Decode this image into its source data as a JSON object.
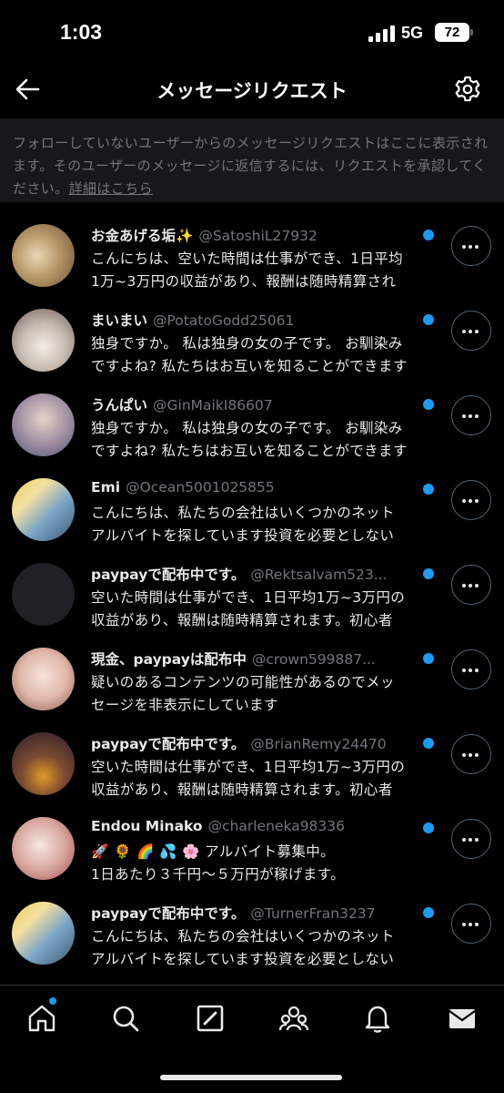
{
  "status_bar": {
    "time": "1:03",
    "network": "5G",
    "battery": "72"
  },
  "header": {
    "title": "メッセージリクエスト",
    "back_icon": "arrow-left-icon",
    "settings_icon": "gear-icon"
  },
  "notice": {
    "text": "フォローしていないユーザーからのメッセージリクエストはここに表示されます。そのユーザーのメッセージに返信するには、リクエストを承認してください。",
    "link": "詳細はこちら"
  },
  "requests": [
    {
      "name": "お金あげる垢✨",
      "handle": "@SatoshiL27932",
      "message": "こんにちは、空いた時間は仕事ができ、1日平均\n1万~3万円の収益があり、報酬は随時精算され",
      "unread": true
    },
    {
      "name": "まいまい",
      "handle": "@PotatoGodd25061",
      "message": "独身ですか。 私は独身の女の子です。 お馴染み\nですよね? 私たちはお互いを知ることができます",
      "unread": true
    },
    {
      "name": "うんぱい",
      "handle": "@GinMaikI86607",
      "message": "独身ですか。 私は独身の女の子です。 お馴染み\nですよね? 私たちはお互いを知ることができます",
      "unread": true
    },
    {
      "name": "Emi",
      "handle": "@Ocean5001025855",
      "message": "こんにちは、私たちの会社はいくつかのネット\nアルバイトを探しています投資を必要としない",
      "unread": true
    },
    {
      "name": "paypayで配布中です。",
      "handle": "@Rektsalvam523...",
      "message": "空いた時間は仕事ができ、1日平均1万~3万円の\n収益があり、報酬は随時精算されます。初心者",
      "unread": true
    },
    {
      "name": "現金、paypayは配布中",
      "handle": "@crown599887...",
      "message": "疑いのあるコンテンツの可能性があるのでメッ\nセージを非表示にしています",
      "unread": true
    },
    {
      "name": "paypayで配布中です。",
      "handle": "@BrianRemy24470",
      "message": "空いた時間は仕事ができ、1日平均1万~3万円の\n収益があり、報酬は随時精算されます。初心者",
      "unread": true
    },
    {
      "name": "Endou Minako",
      "handle": "@charleneka98336",
      "message": "🚀 🌻 🌈 💦 🌸 アルバイト募集中。\n1日あたり３千円～５万円が稼げます。",
      "unread": true
    },
    {
      "name": "paypayで配布中です。",
      "handle": "@TurnerFran3237",
      "message": "こんにちは、私たちの会社はいくつかのネット\nアルバイトを探しています投資を必要としない",
      "unread": true
    }
  ],
  "tab_bar": {
    "tabs": [
      "home-icon",
      "search-icon",
      "grok-icon",
      "communities-icon",
      "notifications-icon",
      "messages-icon"
    ],
    "home_has_badge": true
  },
  "colors": {
    "accent": "#1d9bf0",
    "background": "#000000",
    "muted_text": "#71767b"
  }
}
